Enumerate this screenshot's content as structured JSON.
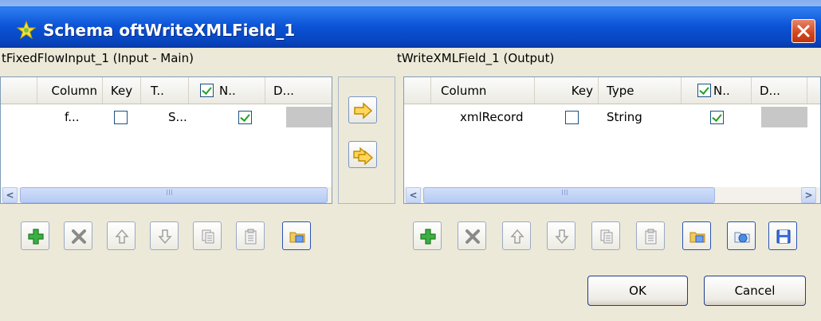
{
  "window": {
    "title": "Schema oftWriteXMLField_1"
  },
  "input": {
    "label": "tFixedFlowInput_1 (Input - Main)",
    "headers": {
      "column": "Column",
      "key": "Key",
      "type": "T..",
      "nullable": "N..",
      "default": "D..."
    },
    "rows": [
      {
        "column": "f...",
        "key": false,
        "type": "S...",
        "nullable": true
      }
    ],
    "scroll_grip": "III"
  },
  "output": {
    "label": "tWriteXMLField_1 (Output)",
    "headers": {
      "column": "Column",
      "key": "Key",
      "type": "Type",
      "nullable": "N..",
      "default": "D..."
    },
    "rows": [
      {
        "column": "xmlRecord",
        "key": false,
        "type": "String",
        "nullable": true
      }
    ],
    "scroll_grip": "III"
  },
  "buttons": {
    "ok": "OK",
    "cancel": "Cancel"
  },
  "colors": {
    "titlebar": "#0b53d6",
    "dialog_bg": "#ece9d8",
    "add_green": "#2aa02a"
  }
}
